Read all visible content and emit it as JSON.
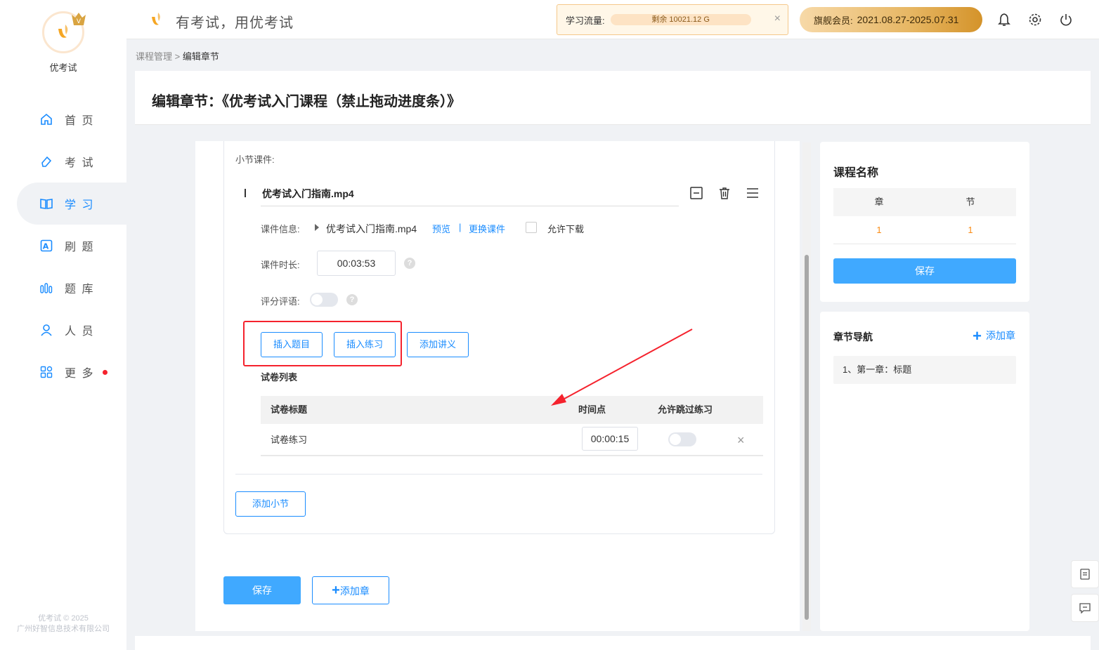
{
  "app": {
    "brand": "优考试",
    "slogan": "有考试，用优考试",
    "copyright_line1": "优考试 © 2025",
    "copyright_line2": "广州好智信息技术有限公司"
  },
  "sidebar": {
    "items": [
      {
        "label": "首 页",
        "icon": "home-icon"
      },
      {
        "label": "考 试",
        "icon": "eraser-icon"
      },
      {
        "label": "学 习",
        "icon": "book-icon",
        "active": true
      },
      {
        "label": "刷 题",
        "icon": "letter-a-icon"
      },
      {
        "label": "题 库",
        "icon": "bars-icon"
      },
      {
        "label": "人 员",
        "icon": "user-icon"
      },
      {
        "label": "更 多",
        "icon": "grid-icon",
        "badge_dot": true
      }
    ]
  },
  "header": {
    "flow_label": "学习流量:",
    "flow_remaining": "剩余 10021.12 G",
    "flow_close": "×",
    "vip_label": "旗舰会员:",
    "vip_period": "2021.08.27-2025.07.31"
  },
  "breadcrumb": {
    "parent": "课程管理",
    "sep": ">",
    "current": "编辑章节"
  },
  "page": {
    "title": "编辑章节：《优考试入门课程（禁止拖动进度条）》"
  },
  "section": {
    "courseware_label": "小节课件:",
    "file_title": "优考试入门指南.mp4",
    "info_label": "课件信息:",
    "info_file": "优考试入门指南.mp4",
    "preview_link": "预览",
    "pipe": "|",
    "replace_link": "更换课件",
    "allow_download": "允许下载",
    "duration_label": "课件时长:",
    "duration_value": "00:03:53",
    "rating_label": "评分评语:",
    "help_mark": "?",
    "btn_insert_question": "插入题目",
    "btn_insert_practice": "插入练习",
    "btn_add_handout": "添加讲义",
    "paper_list_title": "试卷列表",
    "table": {
      "headers": [
        "试卷标题",
        "时间点",
        "允许跳过练习"
      ],
      "rows": [
        {
          "title": "试卷练习",
          "time": "00:00:15",
          "allow_skip": false
        }
      ],
      "remove_mark": "×"
    },
    "btn_add_subsection": "添加小节"
  },
  "footer_actions": {
    "save": "保存",
    "add_chapter": "添加章",
    "add_chapter_plus": "+"
  },
  "right_panel": {
    "course_name_title": "课程名称",
    "col_chapter": "章",
    "col_section": "节",
    "chapter_count": "1",
    "section_count": "1",
    "save": "保存",
    "nav_title": "章节导航",
    "add_chapter": "添加章",
    "add_plus": "+",
    "nav_items": [
      "1、第一章：标题"
    ]
  },
  "colors": {
    "accent": "#1a8cff",
    "primary_button": "#40a9ff",
    "highlight_red": "#f5222d",
    "orange": "#fa8c16"
  }
}
